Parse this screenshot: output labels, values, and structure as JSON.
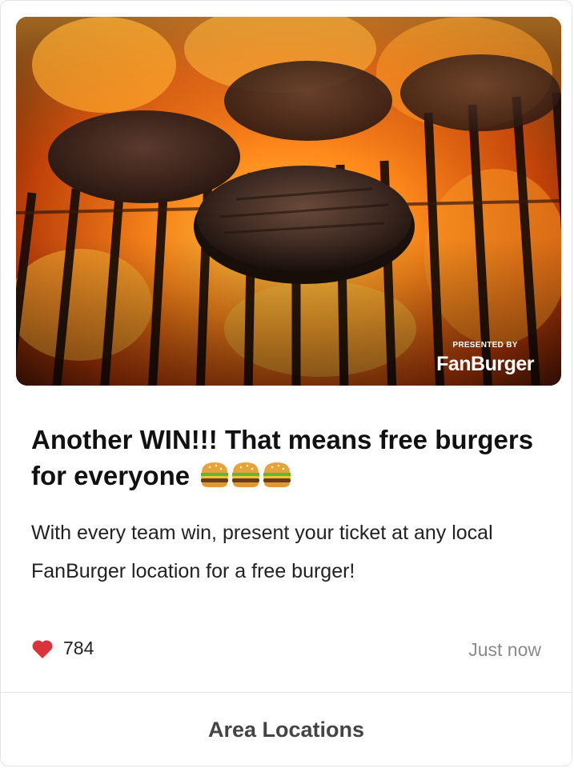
{
  "post": {
    "sponsor_prefix": "PRESENTED BY",
    "sponsor_brand": "FanBurger",
    "title": "Another WIN!!! That means free burgers for everyone",
    "title_emoji": "🍔🍔🍔",
    "body": "With every team win, present your ticket at any local FanBurger location for a free burger!",
    "likes": "784",
    "timestamp": "Just now",
    "cta_label": "Area Locations"
  },
  "icons": {
    "like": "heart-icon",
    "title_emoji": "burger-emoji-icon"
  },
  "colors": {
    "heart": "#d9343b",
    "timestamp": "#8a8a8a",
    "cta_text": "#444444"
  }
}
